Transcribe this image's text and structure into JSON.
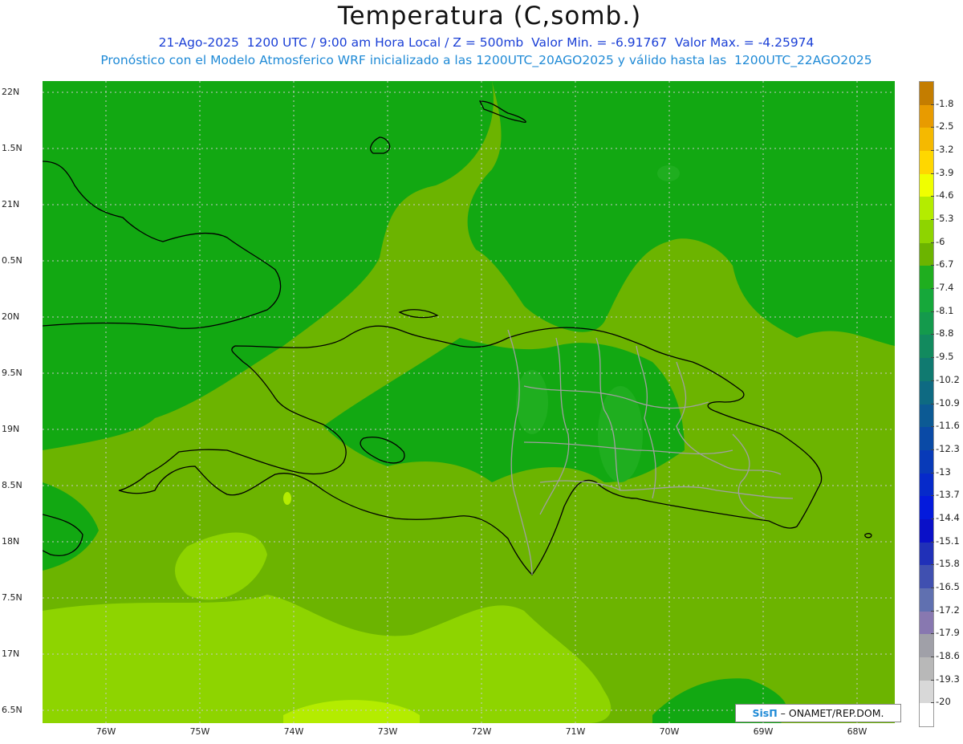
{
  "title": "Temperatura (C,somb.)",
  "subtitle_line1": "21-Ago-2025  1200 UTC / 9:00 am Hora Local / Z = 500mb  Valor Min. = -6.91767  Valor Max. = -4.25974",
  "subtitle_line2": "Pronóstico con el Modelo Atmosferico WRF inicializado a las 1200UTC_20AGO2025 y válido hasta las  1200UTC_22AGO2025",
  "y_axis_labels": [
    "22N",
    "1.5N",
    "21N",
    "0.5N",
    "20N",
    "9.5N",
    "19N",
    "8.5N",
    "18N",
    "7.5N",
    "17N",
    "6.5N"
  ],
  "x_axis_labels": [
    "76W",
    "75W",
    "74W",
    "73W",
    "72W",
    "71W",
    "70W",
    "69W",
    "68W"
  ],
  "legend": {
    "labels": [
      "-1.8",
      "-2.5",
      "-3.2",
      "-3.9",
      "-4.6",
      "-5.3",
      "-6",
      "-6.7",
      "-7.4",
      "-8.1",
      "-8.8",
      "-9.5",
      "-10.2",
      "-10.9",
      "-11.6",
      "-12.3",
      "-13",
      "-13.7",
      "-14.4",
      "-15.1",
      "-15.8",
      "-16.5",
      "-17.2",
      "-17.9",
      "-18.6",
      "-19.3",
      "-20"
    ],
    "colors": [
      "#c47d00",
      "#e89b00",
      "#f5b900",
      "#ffd700",
      "#f0ff00",
      "#b4ec00",
      "#8ed400",
      "#6cb400",
      "#1fae1f",
      "#16a83a",
      "#149a4c",
      "#128a5e",
      "#107a70",
      "#0e6a82",
      "#0c5a94",
      "#0a4aa6",
      "#083ab8",
      "#062aca",
      "#041adc",
      "#0a10c8",
      "#2030b8",
      "#4050b0",
      "#6070b0",
      "#8878b0",
      "#a0a0a8",
      "#b8b8b8",
      "#d8d8d8",
      "#ffffff"
    ]
  },
  "colors": {
    "field_base": "#6cb400",
    "field_cold": "#12a812",
    "field_cold2": "#1fae1f",
    "field_warm": "#8ed400",
    "field_warmest": "#b4ec00",
    "coastline": "#000000",
    "province_lines": "#a0a0a0"
  },
  "credit": {
    "brand": "SisΠ",
    "text": " – ONAMET/REP.DOM."
  }
}
